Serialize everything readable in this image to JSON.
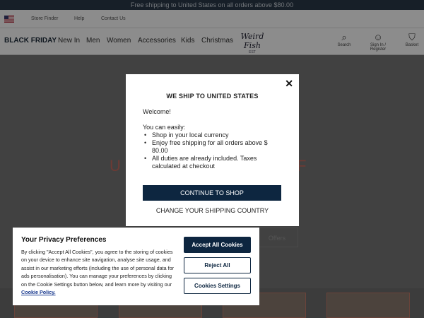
{
  "topbar": {
    "text": "Free shipping to United States on all orders above $80.00"
  },
  "utility": {
    "links": [
      "Store Finder",
      "Help",
      "Contact Us"
    ]
  },
  "nav": {
    "items": [
      "BLACK FRIDAY",
      "New In",
      "Men",
      "Women",
      "Accessories",
      "Kids",
      "Christmas"
    ],
    "logo": "Weird Fish",
    "logo_sub": "EST",
    "icons": [
      {
        "name": "search-icon",
        "glyph": "⌕",
        "label": "Search"
      },
      {
        "name": "user-icon",
        "glyph": "☺",
        "label": "Sign In / Register"
      },
      {
        "name": "basket-icon",
        "glyph": "⛉",
        "label": "Basket"
      }
    ]
  },
  "hero": {
    "text_left": "U",
    "text_right": "F",
    "button": "Offers"
  },
  "shipping_modal": {
    "title": "WE SHIP TO UNITED STATES",
    "close": "✕",
    "welcome": "Welcome!",
    "intro": "You can easily:",
    "bullets": [
      "Shop in your local currency",
      "Enjoy free shipping for all orders above $ 80.00",
      "All duties are already included. Taxes calculated at checkout"
    ],
    "continue_label": "CONTINUE TO SHOP",
    "change_label": "CHANGE YOUR SHIPPING COUNTRY"
  },
  "cookie_banner": {
    "title": "Your Privacy Preferences",
    "text": "By clicking \"Accept All Cookies\", you agree to the storing of cookies on your device to enhance site navigation, analyse site usage, and assist in our marketing efforts (including the use of personal data for ads personalisation). You can manage your preferences by clicking on the Cookie Settings button below, and learn more by visiting our ",
    "policy_link": "Cookie Policy.",
    "accept_label": "Accept All Cookies",
    "reject_label": "Reject All",
    "settings_label": "Cookies Settings"
  },
  "colors": {
    "navy": "#0d2640",
    "hero_accent": "#c76b5f"
  }
}
